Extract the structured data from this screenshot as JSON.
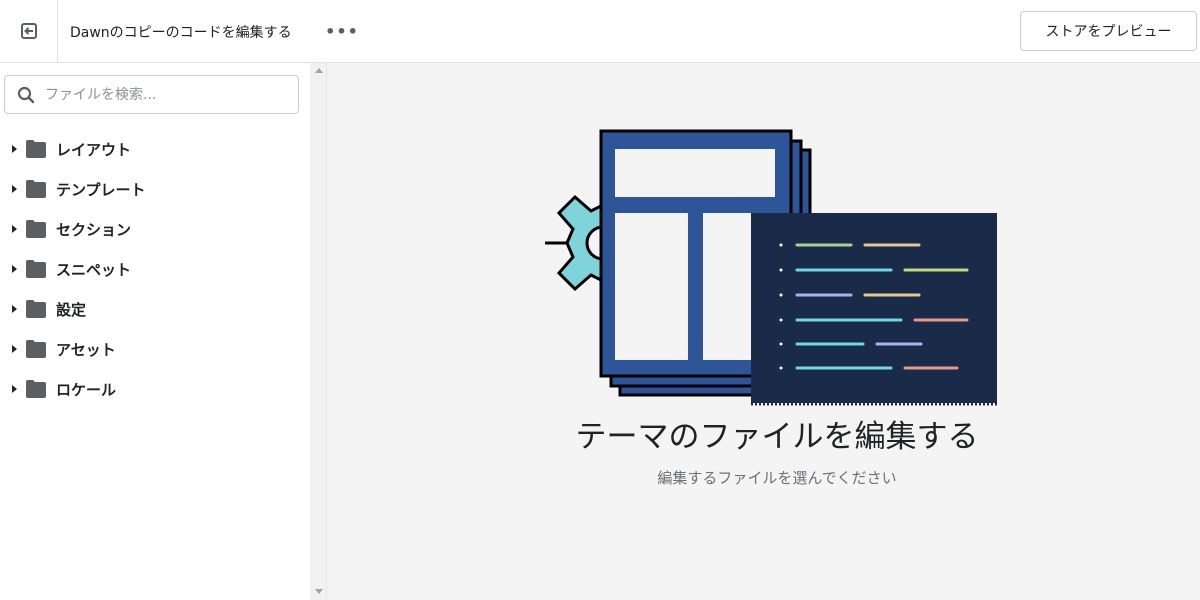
{
  "header": {
    "title": "Dawnのコピーのコードを編集する",
    "more_label": "•••",
    "preview_label": "ストアをプレビュー",
    "back_icon": "exit-icon"
  },
  "sidebar": {
    "search": {
      "placeholder": "ファイルを検索...",
      "value": "",
      "icon": "search-icon"
    },
    "folders": [
      {
        "label": "レイアウト",
        "icon": "folder-icon"
      },
      {
        "label": "テンプレート",
        "icon": "folder-icon"
      },
      {
        "label": "セクション",
        "icon": "folder-icon"
      },
      {
        "label": "スニペット",
        "icon": "folder-icon"
      },
      {
        "label": "設定",
        "icon": "folder-icon"
      },
      {
        "label": "アセット",
        "icon": "folder-icon"
      },
      {
        "label": "ロケール",
        "icon": "folder-icon"
      }
    ]
  },
  "main": {
    "heading": "テーマのファイルを編集する",
    "subtext": "編集するファイルを選んでください"
  },
  "colors": {
    "primary_text": "#202223",
    "muted_text": "#6d7175",
    "border": "#c9cccf",
    "main_bg": "#f4f4f4",
    "illus_blue": "#2e5597",
    "illus_navy": "#1a2b4a",
    "illus_gear": "#7fd4dc"
  }
}
